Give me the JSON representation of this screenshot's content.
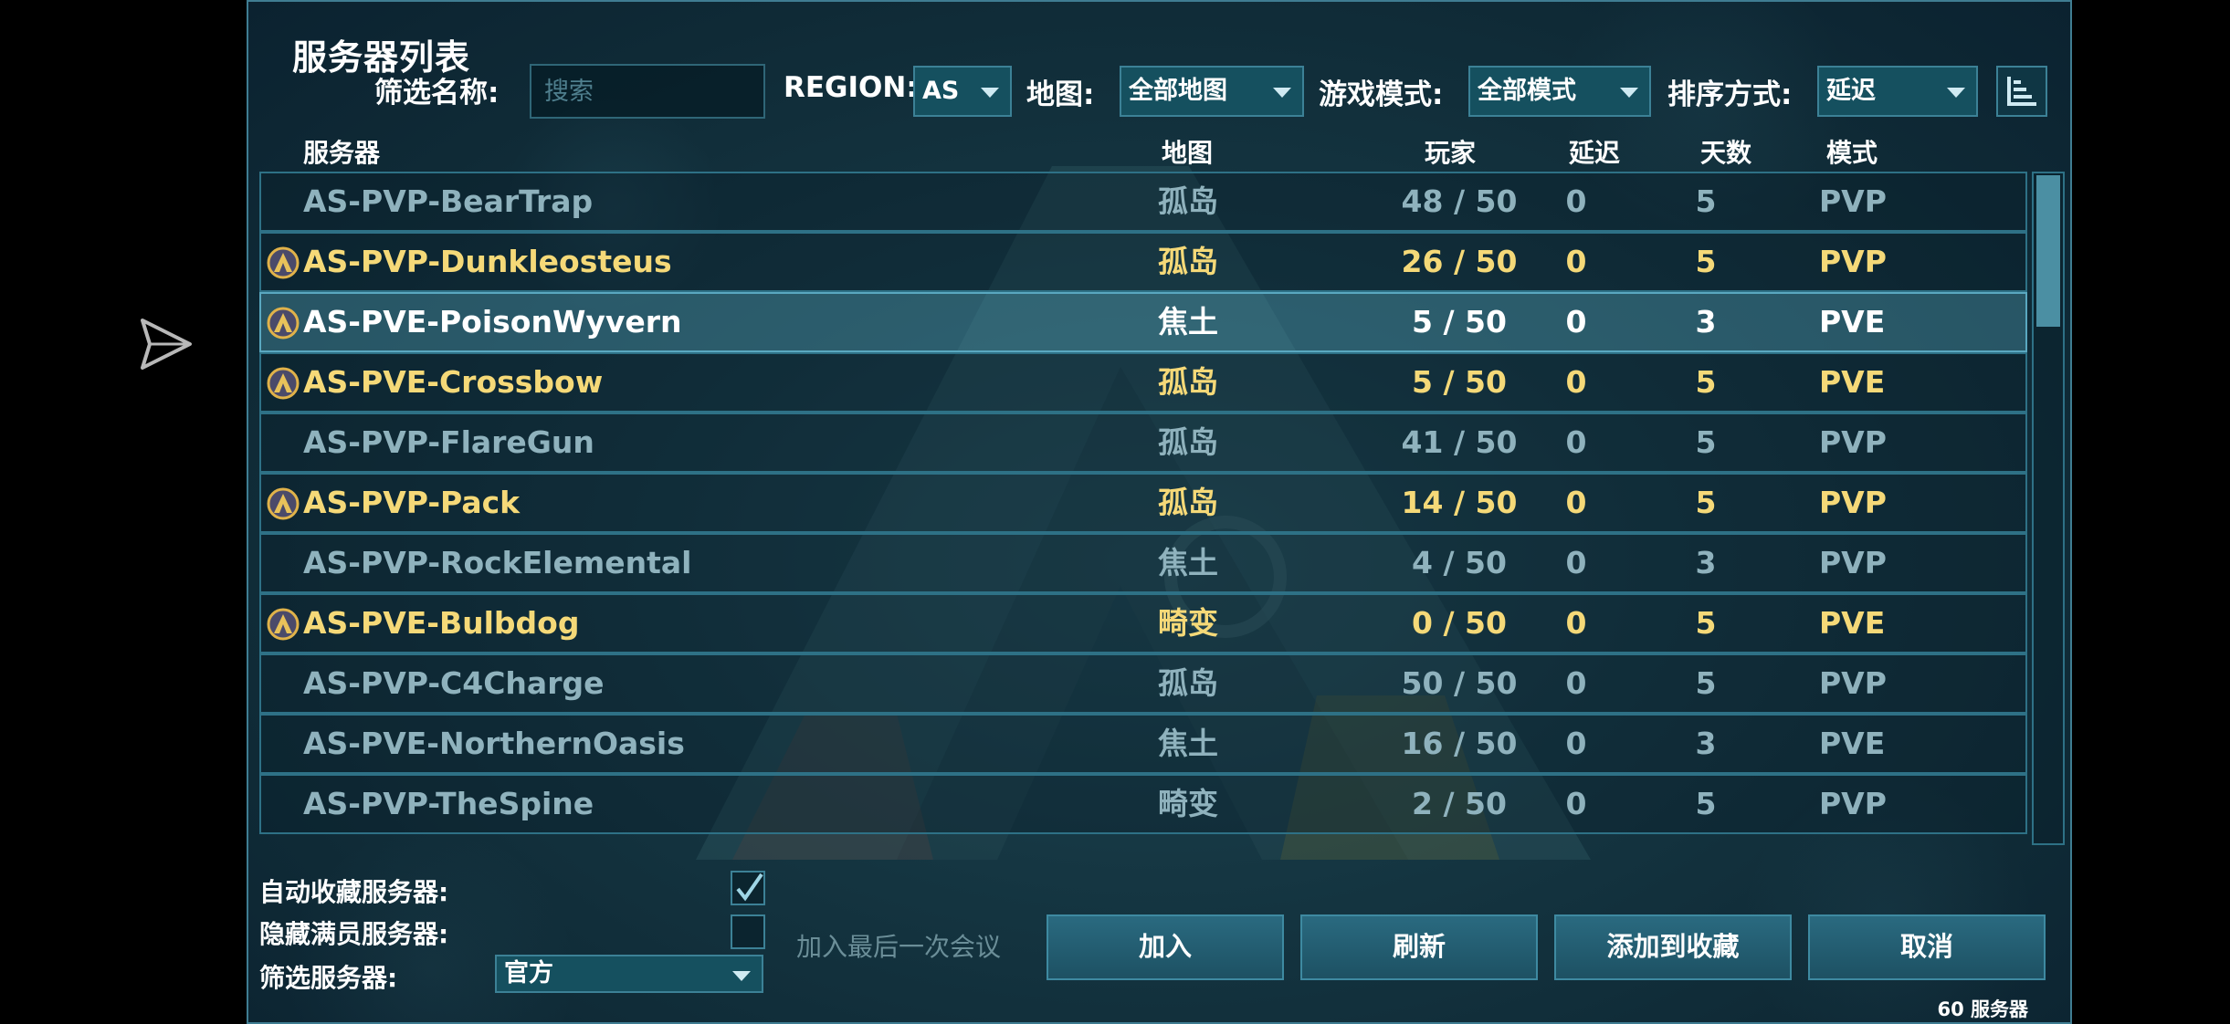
{
  "title": "服务器列表",
  "filters": {
    "name_label": "筛选名称:",
    "search_placeholder": "搜索",
    "region_label": "REGION:",
    "region_value": "AS",
    "map_label": "地图:",
    "map_value": "全部地图",
    "mode_label": "游戏模式:",
    "mode_value": "全部模式",
    "sort_label": "排序方式:",
    "sort_value": "延迟"
  },
  "columns": {
    "server": "服务器",
    "map": "地图",
    "players": "玩家",
    "ping": "延迟",
    "days": "天数",
    "mode": "模式"
  },
  "rows": [
    {
      "name": "AS-PVP-BearTrap",
      "map": "孤岛",
      "players": "48 / 50",
      "ping": "0",
      "days": "5",
      "mode": "PVP",
      "fav": false,
      "selected": false
    },
    {
      "name": "AS-PVP-Dunkleosteus",
      "map": "孤岛",
      "players": "26 / 50",
      "ping": "0",
      "days": "5",
      "mode": "PVP",
      "fav": true,
      "selected": false
    },
    {
      "name": "AS-PVE-PoisonWyvern",
      "map": "焦土",
      "players": "5 / 50",
      "ping": "0",
      "days": "3",
      "mode": "PVE",
      "fav": true,
      "selected": true
    },
    {
      "name": "AS-PVE-Crossbow",
      "map": "孤岛",
      "players": "5 / 50",
      "ping": "0",
      "days": "5",
      "mode": "PVE",
      "fav": true,
      "selected": false
    },
    {
      "name": "AS-PVP-FlareGun",
      "map": "孤岛",
      "players": "41 / 50",
      "ping": "0",
      "days": "5",
      "mode": "PVP",
      "fav": false,
      "selected": false
    },
    {
      "name": "AS-PVP-Pack",
      "map": "孤岛",
      "players": "14 / 50",
      "ping": "0",
      "days": "5",
      "mode": "PVP",
      "fav": true,
      "selected": false
    },
    {
      "name": "AS-PVP-RockElemental",
      "map": "焦土",
      "players": "4 / 50",
      "ping": "0",
      "days": "3",
      "mode": "PVP",
      "fav": false,
      "selected": false
    },
    {
      "name": "AS-PVE-Bulbdog",
      "map": "畸变",
      "players": "0 / 50",
      "ping": "0",
      "days": "5",
      "mode": "PVE",
      "fav": true,
      "selected": false
    },
    {
      "name": "AS-PVP-C4Charge",
      "map": "孤岛",
      "players": "50 / 50",
      "ping": "0",
      "days": "5",
      "mode": "PVP",
      "fav": false,
      "selected": false
    },
    {
      "name": "AS-PVE-NorthernOasis",
      "map": "焦土",
      "players": "16 / 50",
      "ping": "0",
      "days": "3",
      "mode": "PVE",
      "fav": false,
      "selected": false
    },
    {
      "name": "AS-PVP-TheSpine",
      "map": "畸变",
      "players": "2 / 50",
      "ping": "0",
      "days": "5",
      "mode": "PVP",
      "fav": false,
      "selected": false
    }
  ],
  "options": {
    "auto_fav_label": "自动收藏服务器:",
    "auto_fav_checked": true,
    "hide_full_label": "隐藏满员服务器:",
    "hide_full_checked": false,
    "filter_server_label": "筛选服务器:",
    "filter_server_value": "官方"
  },
  "join_last_label": "加入最后一次会议",
  "buttons": {
    "join": "加入",
    "refresh": "刷新",
    "add_fav": "添加到收藏",
    "cancel": "取消"
  },
  "server_count": "60 服务器",
  "colors": {
    "favorite_text": "#f5d978",
    "normal_text": "#8fb2bd",
    "accent": "#3c8196"
  }
}
